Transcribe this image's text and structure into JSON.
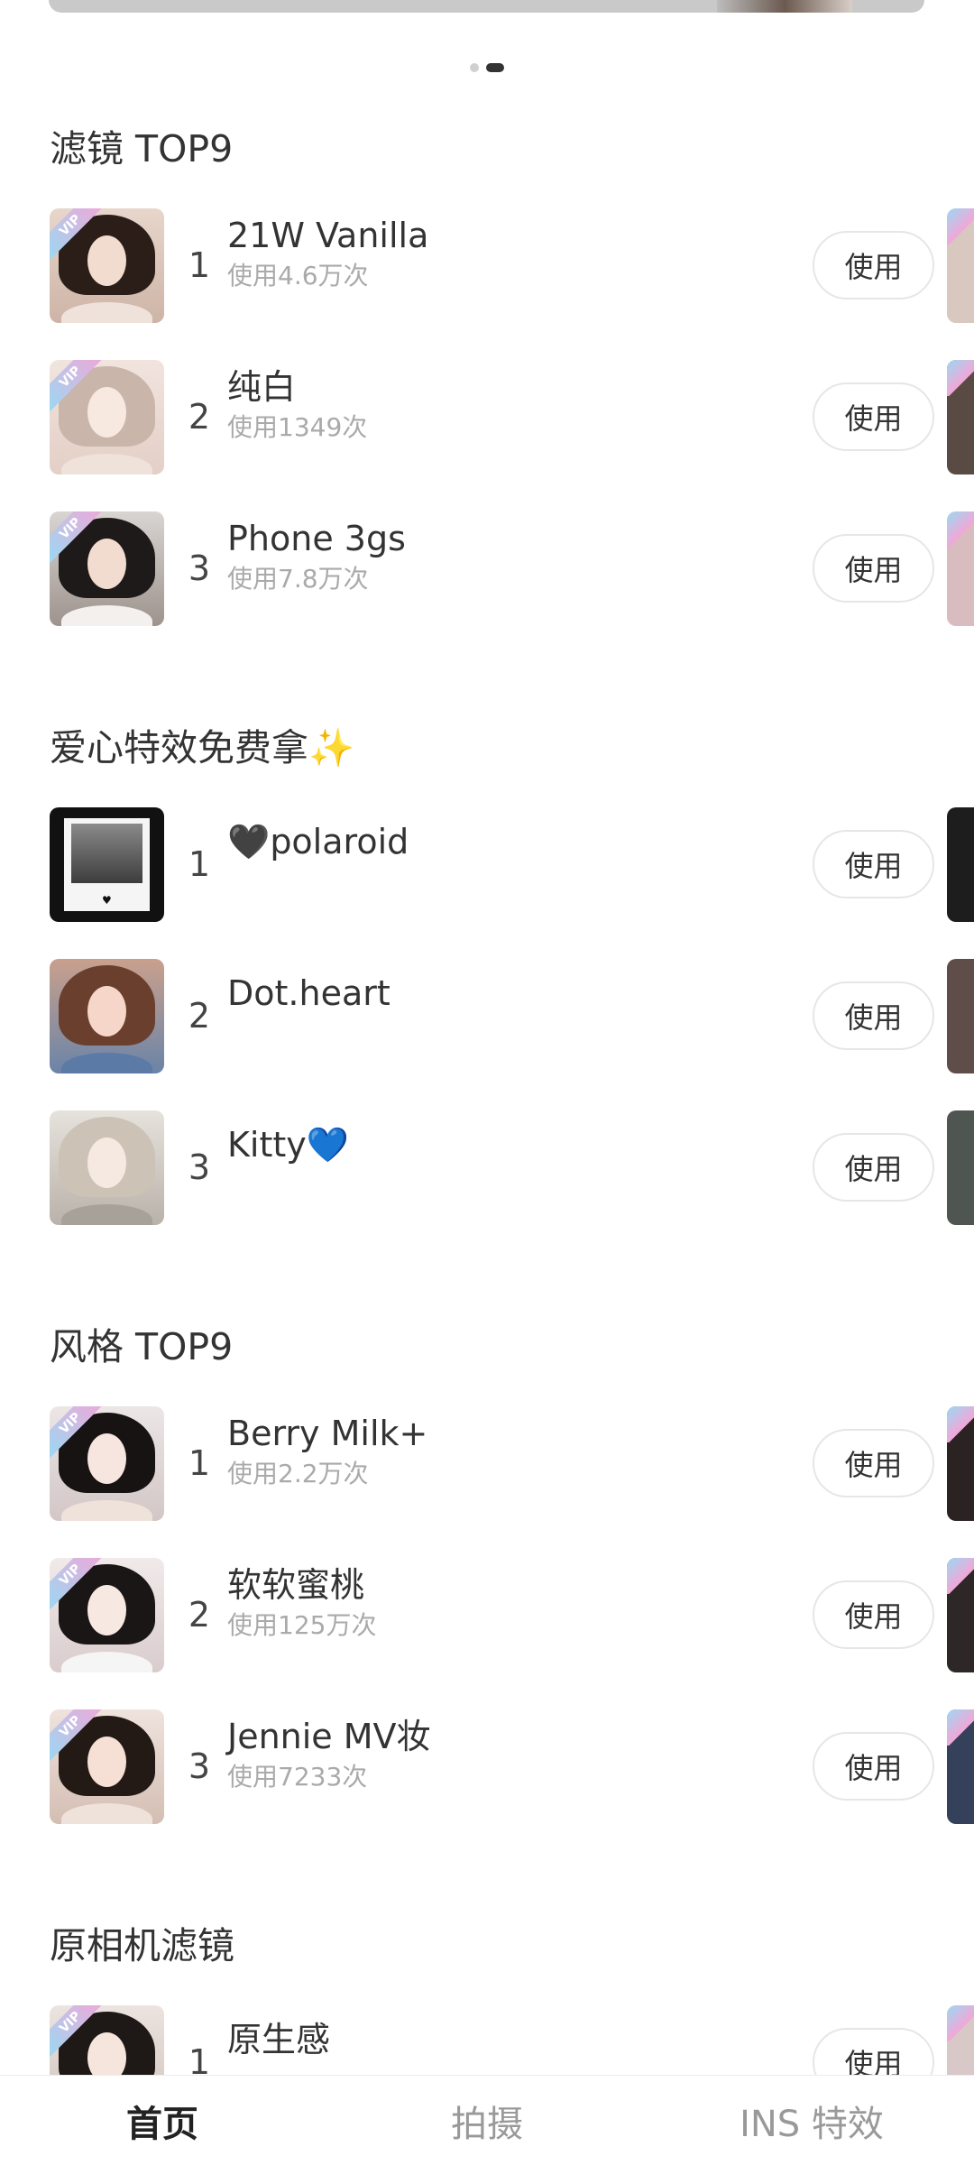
{
  "banner": {
    "pages": 2,
    "active_index": 1
  },
  "sections": [
    {
      "title": "滤镜 TOP9",
      "items": [
        {
          "rank": "1",
          "name": "21W Vanilla",
          "count": "使用4.6万次",
          "vip": true
        },
        {
          "rank": "2",
          "name": "纯白",
          "count": "使用1349次",
          "vip": true
        },
        {
          "rank": "3",
          "name": "Phone 3gs",
          "count": "使用7.8万次",
          "vip": true
        }
      ]
    },
    {
      "title": "爱心特效免费拿",
      "title_icon": "✨",
      "items": [
        {
          "rank": "1",
          "name": "🖤polaroid",
          "count": "",
          "vip": false
        },
        {
          "rank": "2",
          "name": "Dot.heart",
          "count": "",
          "vip": false
        },
        {
          "rank": "3",
          "name": "Kitty💙",
          "count": "",
          "vip": false
        }
      ]
    },
    {
      "title": "风格 TOP9",
      "items": [
        {
          "rank": "1",
          "name": "Berry Milk+",
          "count": "使用2.2万次",
          "vip": true
        },
        {
          "rank": "2",
          "name": "软软蜜桃",
          "count": "使用125万次",
          "vip": true
        },
        {
          "rank": "3",
          "name": "Jennie MV妆",
          "count": "使用7233次",
          "vip": true
        }
      ]
    },
    {
      "title": "原相机滤镜",
      "items": [
        {
          "rank": "1",
          "name": "原生感",
          "count": "",
          "vip": true
        }
      ]
    }
  ],
  "buttons": {
    "use_label": "使用",
    "vip_label": "VIP"
  },
  "bottom_nav": [
    {
      "label": "首页",
      "active": true
    },
    {
      "label": "拍摄",
      "active": false
    },
    {
      "label": "INS 特效",
      "active": false
    }
  ],
  "colors": {
    "accent_vip_start": "#9ad9f3",
    "accent_vip_end": "#f3a6d7",
    "muted_text": "#aaaaaa",
    "active_nav": "#222222"
  }
}
